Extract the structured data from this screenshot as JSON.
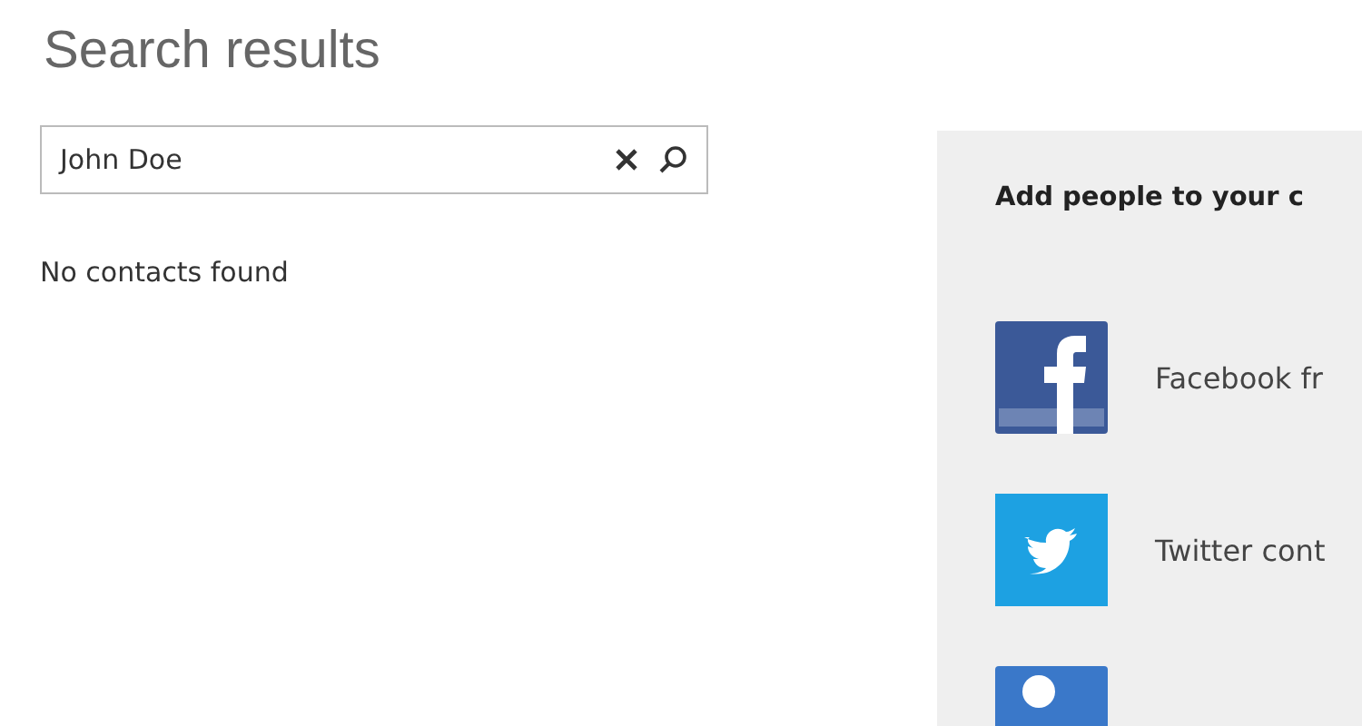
{
  "title": "Search results",
  "search": {
    "value": "John Doe"
  },
  "status": "No contacts found",
  "add_panel": {
    "heading": "Add people to your c",
    "items": [
      {
        "kind": "facebook",
        "label": "Facebook fr"
      },
      {
        "kind": "twitter",
        "label": "Twitter cont"
      },
      {
        "kind": "other"
      }
    ]
  }
}
